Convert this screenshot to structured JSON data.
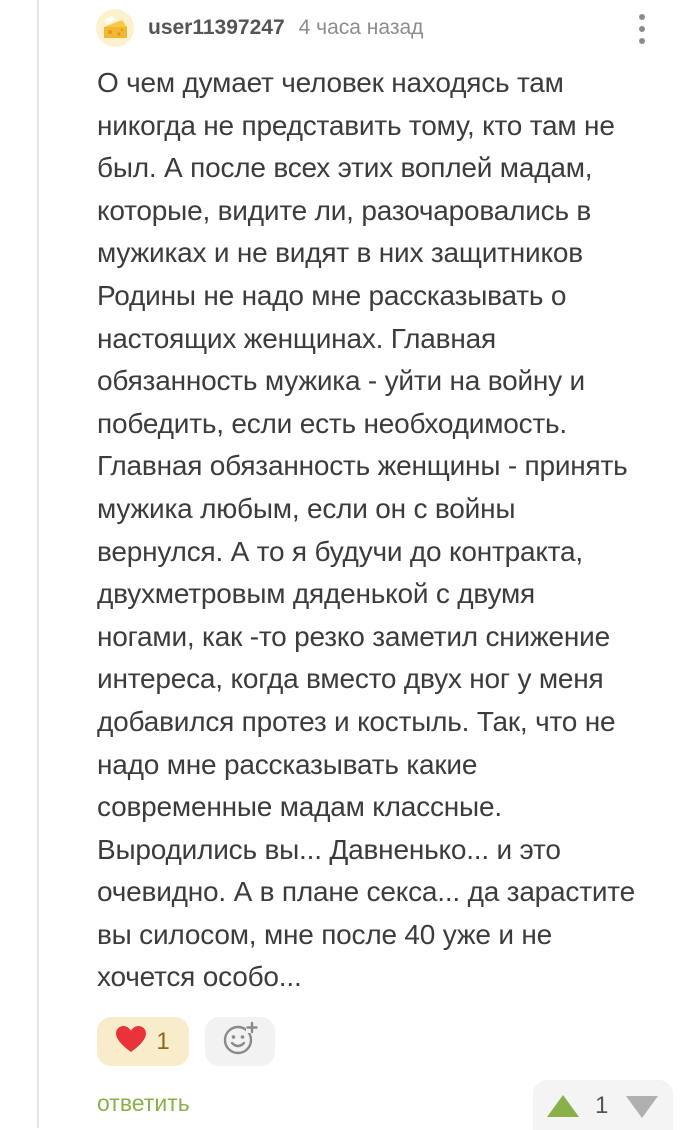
{
  "comment": {
    "author": "user11397247",
    "time": "4 часа назад",
    "lines": [
      "О чем думает человек находясь там",
      "никогда не представить тому, кто там не",
      "был. А после всех этих воплей мадам,",
      "которые, видите ли, разочаровались в",
      "мужиках и не видят в них защитников",
      "Родины не надо мне рассказывать о",
      "настоящих женщинах. Главная",
      "обязанность мужика - уйти на войну и",
      "победить, если есть необходимость.",
      "Главная обязанность женщины - принять",
      "мужика любым, если он с войны",
      "вернулся. А то я будучи до контракта,",
      "двухметровым дяденькой с двумя",
      "ногами, как -то резко заметил снижение",
      "интереса, когда вместо двух ног у меня",
      "добавился протез и костыль. Так, что не",
      "надо мне рассказывать какие",
      "современные мадам классные.",
      "Выродились вы... Давненько... и это",
      "очевидно. А в плане секса... да зарастите",
      "вы силосом, мне после 40 уже и не",
      "хочется особо..."
    ],
    "reactions": {
      "heart_count": "1"
    },
    "reply_label": "ответить",
    "rating": "1"
  },
  "icons": {
    "avatar": "cheese-avatar-icon",
    "more": "more-vertical-icon",
    "heart": "heart-icon",
    "add_reaction": "add-emoji-icon",
    "vote_up": "triangle-up-icon",
    "vote_down": "triangle-down-icon"
  },
  "colors": {
    "heart": "#e8333b",
    "reply": "#8ab04a",
    "vote_up": "#8ab04a",
    "vote_down": "#b0b0b0",
    "like_bg": "#f8eccb"
  }
}
